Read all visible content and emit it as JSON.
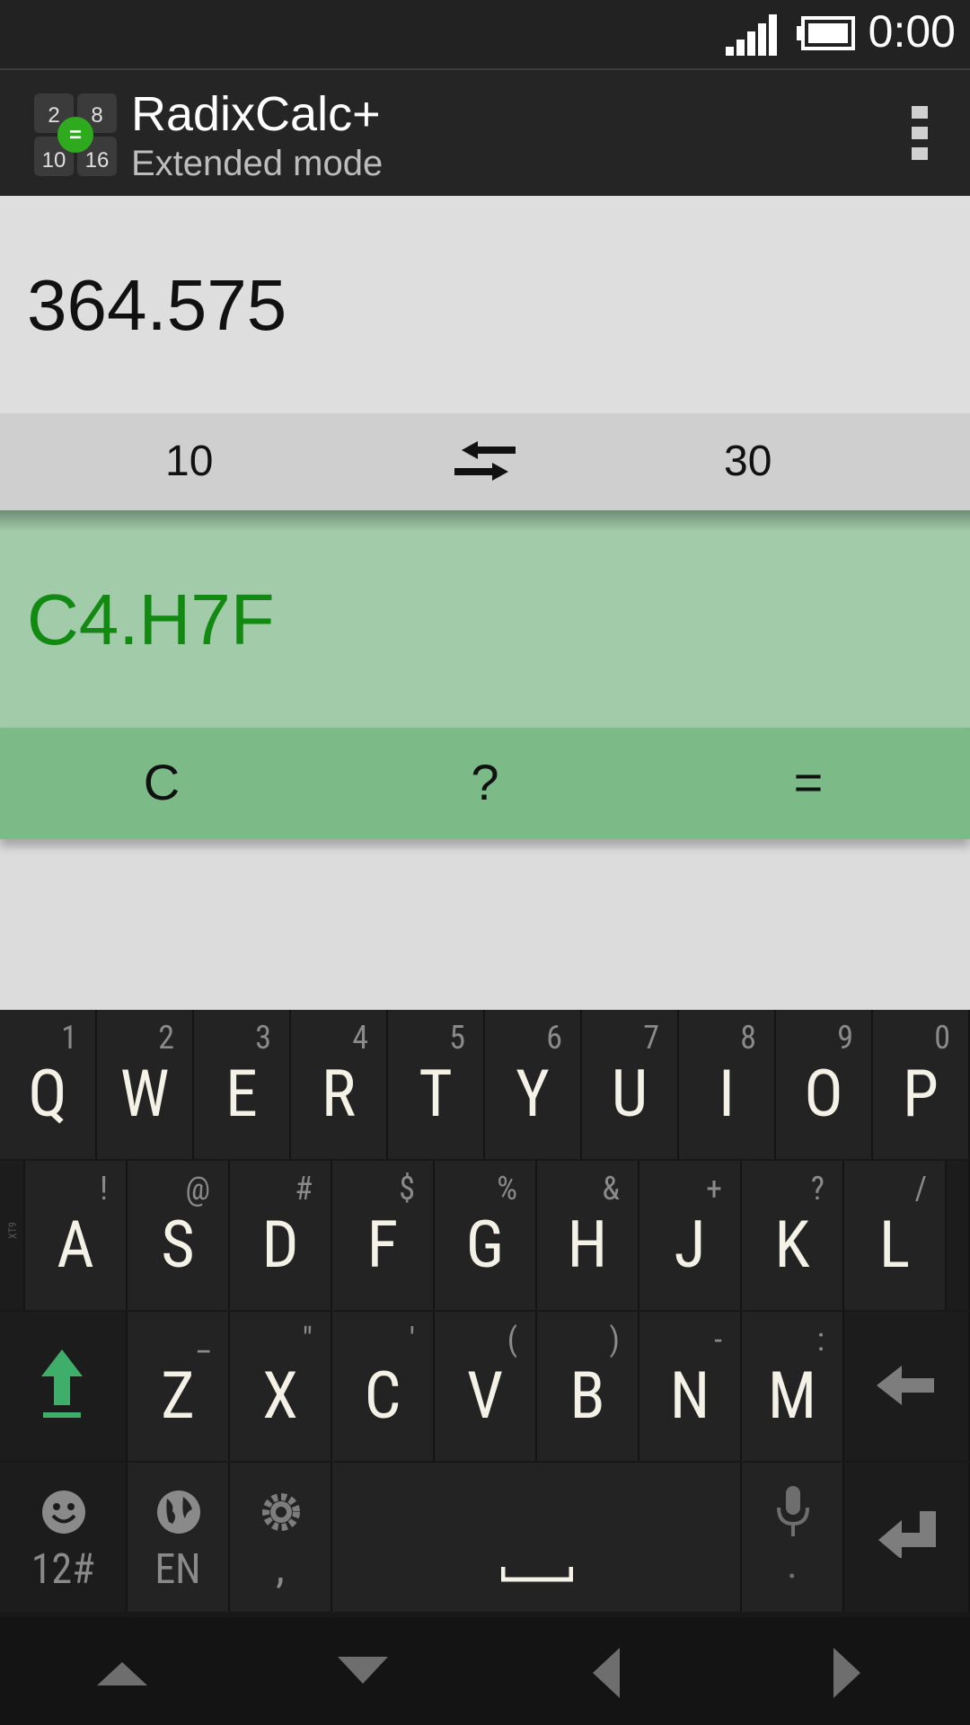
{
  "status_bar": {
    "time": "0:00",
    "icons": [
      "signal-icon",
      "battery-icon"
    ]
  },
  "app": {
    "title": "RadixCalc+",
    "subtitle": "Extended mode",
    "icon_digits": [
      "2",
      "8",
      "10",
      "16"
    ],
    "icon_badge": "="
  },
  "display": {
    "input_value": "364.575",
    "from_radix": "10",
    "to_radix": "30",
    "result_value": "C4.H7F"
  },
  "actions": {
    "clear": "C",
    "help": "?",
    "equals": "="
  },
  "keyboard": {
    "side_label": "XT9",
    "row1": [
      {
        "key": "Q",
        "hint": "1"
      },
      {
        "key": "W",
        "hint": "2"
      },
      {
        "key": "E",
        "hint": "3"
      },
      {
        "key": "R",
        "hint": "4"
      },
      {
        "key": "T",
        "hint": "5"
      },
      {
        "key": "Y",
        "hint": "6"
      },
      {
        "key": "U",
        "hint": "7"
      },
      {
        "key": "I",
        "hint": "8"
      },
      {
        "key": "O",
        "hint": "9"
      },
      {
        "key": "P",
        "hint": "0"
      }
    ],
    "row2": [
      {
        "key": "A",
        "hint": "!"
      },
      {
        "key": "S",
        "hint": "@"
      },
      {
        "key": "D",
        "hint": "#"
      },
      {
        "key": "F",
        "hint": "$"
      },
      {
        "key": "G",
        "hint": "%"
      },
      {
        "key": "H",
        "hint": "&"
      },
      {
        "key": "J",
        "hint": "+"
      },
      {
        "key": "K",
        "hint": "?"
      },
      {
        "key": "L",
        "hint": "/"
      }
    ],
    "row3": [
      {
        "key": "Z",
        "hint": "_"
      },
      {
        "key": "X",
        "hint": "\""
      },
      {
        "key": "C",
        "hint": "'"
      },
      {
        "key": "V",
        "hint": "("
      },
      {
        "key": "B",
        "hint": ")"
      },
      {
        "key": "N",
        "hint": "-"
      },
      {
        "key": "M",
        "hint": ":"
      }
    ],
    "row4": {
      "symbols_label": "12#",
      "language_label": "EN",
      "comma_label": ",",
      "period_label": "."
    }
  },
  "colors": {
    "result_text": "#128a12",
    "result_bg": "#a2cba9",
    "action_bg": "#7cba87",
    "shift_accent": "#3fae6a"
  }
}
